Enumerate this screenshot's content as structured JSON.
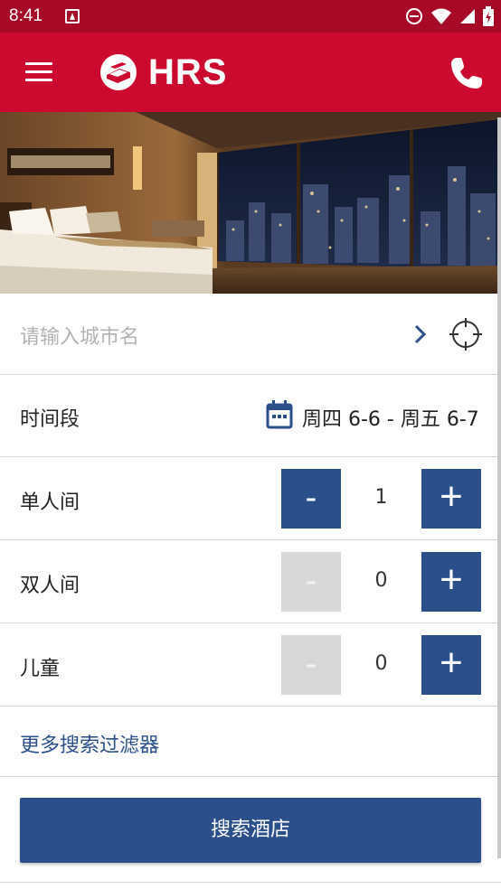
{
  "status_bar": {
    "time": "8:41",
    "icons": [
      "notification-icon",
      "do-not-disturb-icon",
      "wifi-icon",
      "signal-icon",
      "battery-icon"
    ]
  },
  "app_bar": {
    "logo_text": "HRS",
    "icons": [
      "menu-icon",
      "hrs-bed-logo",
      "phone-icon"
    ],
    "background": "#cc0a2f"
  },
  "hero": {
    "description_icon": "hotel-room-image"
  },
  "city": {
    "placeholder": "请输入城市名",
    "icons": [
      "chevron-right-icon",
      "locate-crosshair-icon"
    ]
  },
  "dates": {
    "label": "时间段",
    "value": "周四 6-6 - 周五 6-7",
    "icon": "calendar-icon"
  },
  "rooms": [
    {
      "label": "单人间",
      "count": "1",
      "minus": "-",
      "plus": "+",
      "minus_enabled": true
    },
    {
      "label": "双人间",
      "count": "0",
      "minus": "-",
      "plus": "+",
      "minus_enabled": false
    },
    {
      "label": "儿童",
      "count": "0",
      "minus": "-",
      "plus": "+",
      "minus_enabled": false
    }
  ],
  "more_filters": "更多搜索过滤器",
  "search_button": "搜索酒店",
  "colors": {
    "brand_red": "#cc0a2f",
    "status_red": "#a70a27",
    "accent_blue": "#2b4f8a",
    "disabled_gray": "#d8d8d8"
  }
}
